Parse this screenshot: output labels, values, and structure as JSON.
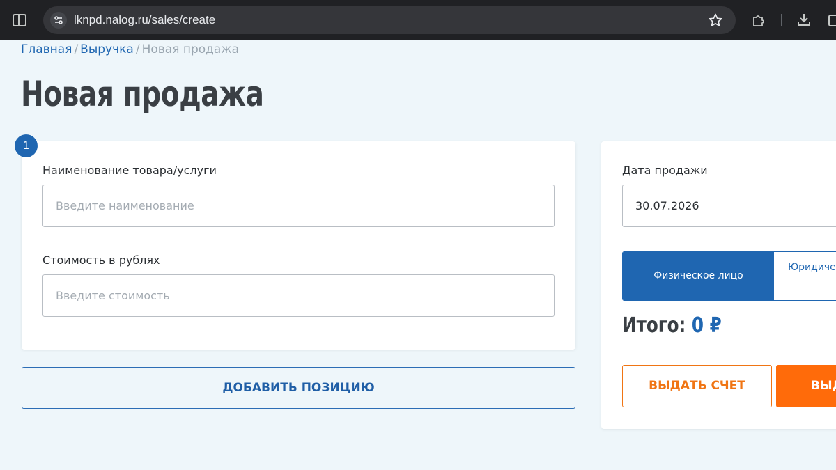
{
  "browser": {
    "url": "lknpd.nalog.ru/sales/create"
  },
  "breadcrumb": {
    "items": [
      "Главная",
      "Выручка",
      "Новая продажа"
    ],
    "separator": "/"
  },
  "page": {
    "title": "Новая продажа"
  },
  "position": {
    "step_number": "1",
    "name_label": "Наименование товара/услуги",
    "name_placeholder": "Введите наименование",
    "price_label": "Стоимость в рублях",
    "price_placeholder": "Введите стоимость"
  },
  "add_position_label": "ДОБАВИТЬ ПОЗИЦИЮ",
  "sale": {
    "date_label": "Дата продажи",
    "date_value": "30.07.2026",
    "buyer_types": [
      "Физическое лицо",
      "Юридиче"
    ],
    "selected_buyer_type": "Физическое лицо",
    "total_label": "Итого:",
    "total_value": "0 ₽",
    "invoice_label": "ВЫДАТЬ СЧЕТ",
    "issue_label": "ВЫД"
  },
  "colors": {
    "accent_blue": "#1f66b1",
    "accent_orange": "#ff6b0a",
    "page_background": "#eef6fa",
    "browser_chrome": "#202124"
  },
  "icons": [
    "sidebar-icon",
    "site-settings-icon",
    "bookmark-star-icon",
    "extensions-icon",
    "download-icon",
    "menu-icon"
  ]
}
